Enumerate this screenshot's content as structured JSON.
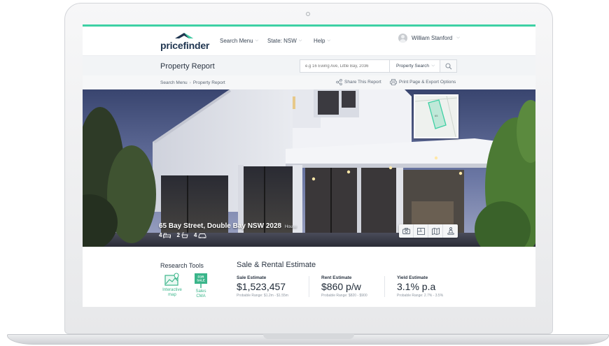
{
  "app": {
    "logo_text": "pricefinder",
    "accent_color": "#3ed0a4",
    "brand_color": "#1f3550"
  },
  "nav": {
    "items": [
      {
        "label": "Search Menu"
      },
      {
        "label": "State: NSW"
      },
      {
        "label": "Help"
      }
    ],
    "user_name": "William Stanford"
  },
  "header": {
    "title": "Property Report",
    "search_placeholder": "e.g 16 Ewing Ave, Little Bay, 2036",
    "search_type": "Property Search"
  },
  "breadcrumb": {
    "items": [
      "Search Menu",
      "Property Report"
    ],
    "share_label": "Share This Report",
    "print_label": "Print Page & Export Options"
  },
  "property": {
    "address": "65 Bay Street, Double Bay NSW 2028",
    "type": "House",
    "beds": "4",
    "baths": "2",
    "cars": "4",
    "map_lot_label": "65"
  },
  "hero_tools": [
    "camera-icon",
    "floorplan-icon",
    "map-icon",
    "streetview-icon"
  ],
  "research_tools": {
    "title": "Research Tools",
    "items": [
      {
        "label_line1": "Interactive",
        "label_line2": "map",
        "icon": "interactive-map-icon"
      },
      {
        "label_line1": "Sales",
        "label_line2": "CMA",
        "icon": "for-sale-sign-icon",
        "sign_text_1": "FOR",
        "sign_text_2": "SALE"
      }
    ]
  },
  "estimates": {
    "title": "Sale & Rental Estimate",
    "items": [
      {
        "label": "Sale Estimate",
        "value": "$1,523,457",
        "range": "Probable Range: $1.2m - $1.55m"
      },
      {
        "label": "Rent Estimate",
        "value": "$860 p/w",
        "range": "Probable Range: $820 - $900"
      },
      {
        "label": "Yield Estimate",
        "value": "3.1% p.a",
        "range": "Probable Range: 2.7% - 3.5%"
      }
    ]
  }
}
